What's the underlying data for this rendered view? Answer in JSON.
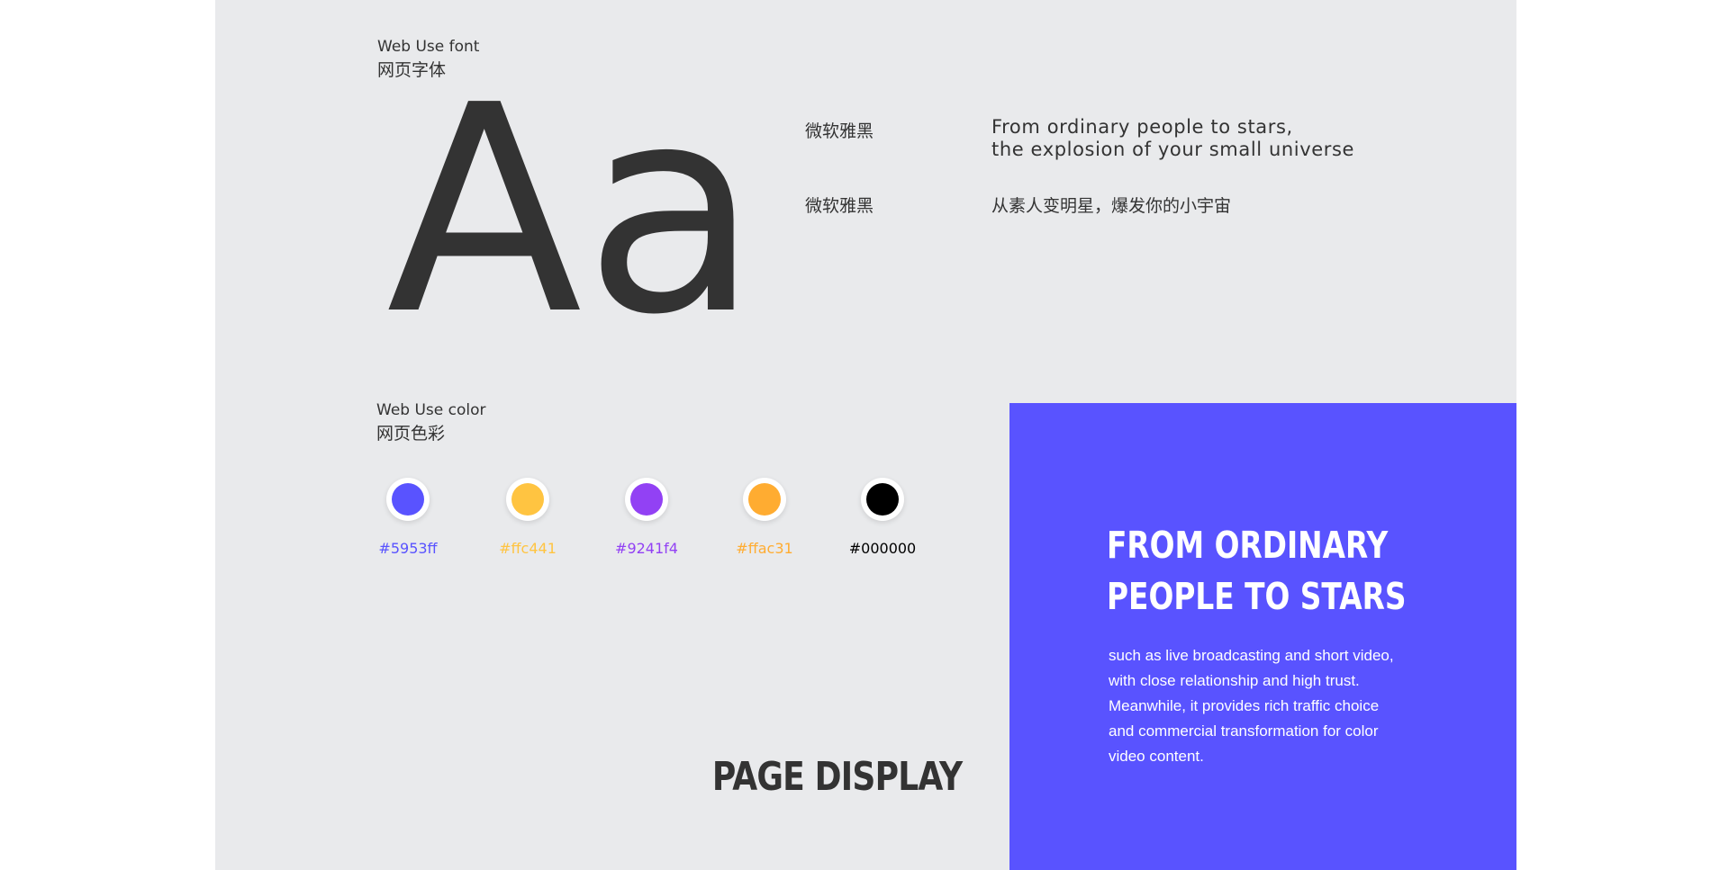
{
  "font_section": {
    "title_en": "Web Use font",
    "title_cn": "网页字体",
    "sample_glyphs": "Aa",
    "rows": [
      {
        "font_name": "微软雅黑",
        "sample_lines": [
          "From ordinary people to stars,",
          "the explosion of your small universe"
        ]
      },
      {
        "font_name": "微软雅黑",
        "sample_lines": [
          "从素人变明星，爆发你的小宇宙"
        ]
      }
    ]
  },
  "color_section": {
    "title_en": "Web Use color",
    "title_cn": "网页色彩",
    "swatches": [
      {
        "hex": "#5953ff",
        "label": "#5953ff",
        "label_color": "#5953ff"
      },
      {
        "hex": "#ffc441",
        "label": "#ffc441",
        "label_color": "#ffc441"
      },
      {
        "hex": "#9241f4",
        "label": "#9241f4",
        "label_color": "#9241f4"
      },
      {
        "hex": "#ffac31",
        "label": "#ffac31",
        "label_color": "#ffac31"
      },
      {
        "hex": "#000000",
        "label": "#000000",
        "label_color": "#000000"
      }
    ]
  },
  "page_display": {
    "label": "PAGE DISPLAY"
  },
  "promo_panel": {
    "background": "#5953ff",
    "title_lines": [
      "FROM ORDINARY",
      "PEOPLE TO STARS"
    ],
    "body_lines": [
      "such as live broadcasting and short video,",
      "with close relationship and high trust.",
      "Meanwhile, it provides rich traffic choice",
      "and commercial transformation for color",
      "video content."
    ]
  }
}
